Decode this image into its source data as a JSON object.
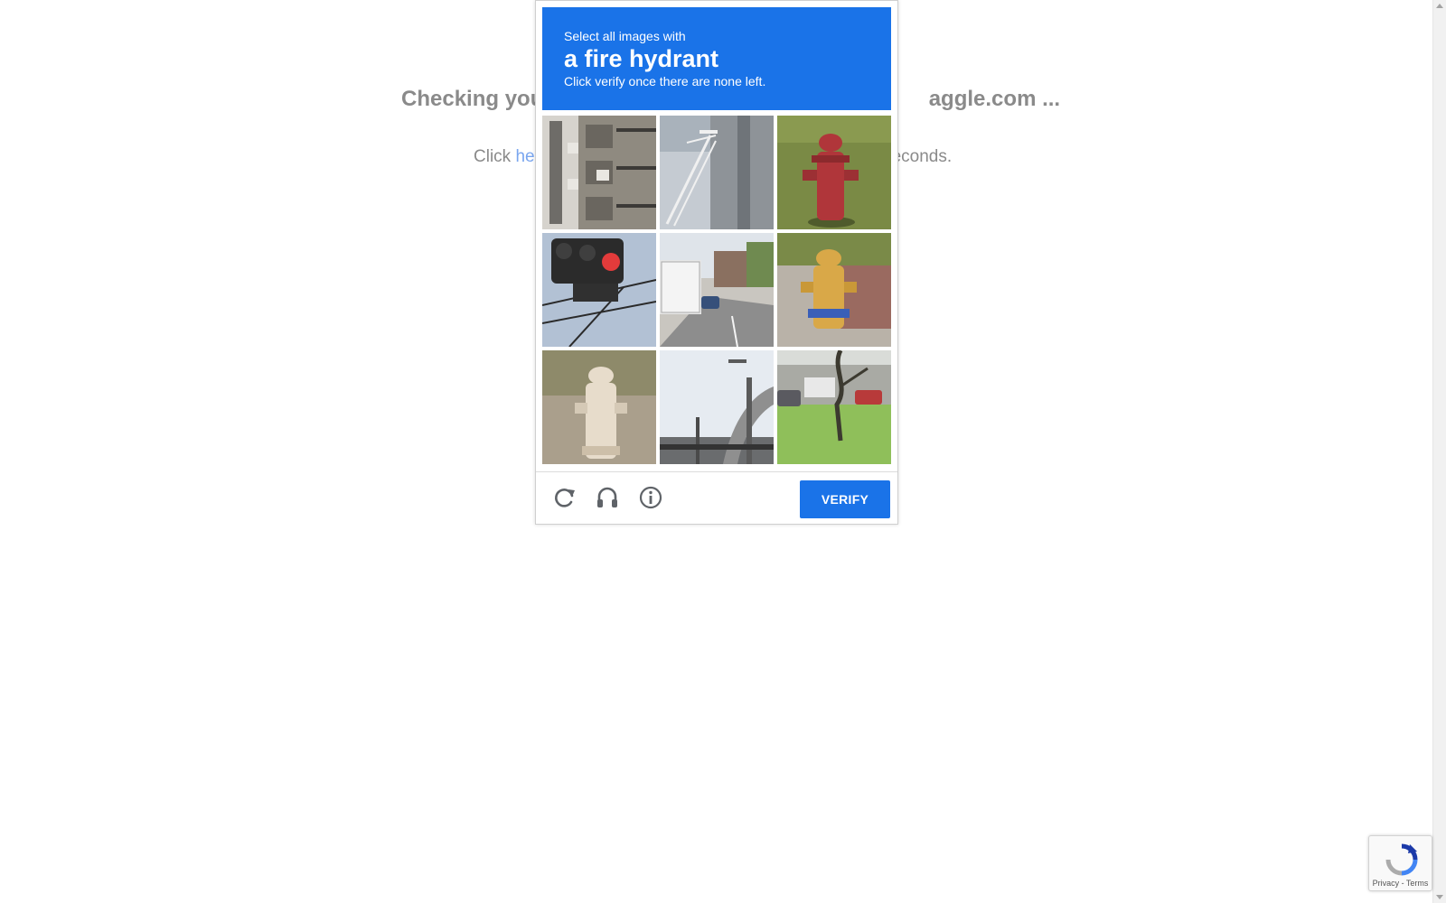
{
  "background_page": {
    "heading_left": "Checking you",
    "heading_right": "aggle.com ...",
    "subtext_left": "Click ",
    "subtext_link": "he",
    "subtext_right": "econds."
  },
  "captcha": {
    "header": {
      "line1": "Select all images with",
      "target": "a fire hydrant",
      "line3": "Click verify once there are none left."
    },
    "tiles": [
      {
        "subject": "apartment building balconies"
      },
      {
        "subject": "silo with stairs"
      },
      {
        "subject": "red fire hydrant on grass"
      },
      {
        "subject": "traffic light"
      },
      {
        "subject": "road with truck and car"
      },
      {
        "subject": "yellow fire hydrant on sidewalk"
      },
      {
        "subject": "beige fire hydrant in sand"
      },
      {
        "subject": "highway overpass"
      },
      {
        "subject": "tree with parked cars"
      }
    ],
    "footer": {
      "reload_icon": "reload-icon",
      "audio_icon": "headphones-icon",
      "info_icon": "info-icon",
      "verify_label": "VERIFY"
    },
    "colors": {
      "accent": "#1a73e8"
    }
  },
  "badge": {
    "terms": "Privacy - Terms"
  }
}
